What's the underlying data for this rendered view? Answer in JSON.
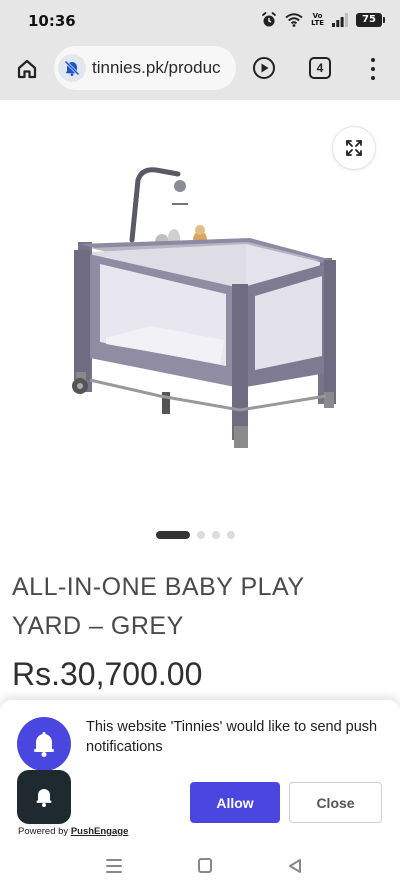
{
  "status_bar": {
    "time": "10:36",
    "lte_top": "Vo",
    "lte_bottom": "LTE",
    "battery": "75"
  },
  "browser": {
    "url": "tinnies.pk/produc",
    "tab_count": "4"
  },
  "product": {
    "title": "ALL-IN-ONE BABY PLAY YARD – GREY",
    "price": "Rs.30,700.00",
    "image_carousel": {
      "total_slides": 4,
      "active_slide": 1
    }
  },
  "push_prompt": {
    "message": "This website 'Tinnies' would like to send push notifications",
    "allow_label": "Allow",
    "close_label": "Close",
    "powered_prefix": "Powered by ",
    "powered_brand": "PushEngage"
  },
  "colors": {
    "accent": "#4a47e0",
    "dark_icon_bg": "#1f2a30",
    "browser_bar": "#e6e6e6",
    "product_grey": "#8a879d"
  },
  "icons": {
    "alarm": "alarm-icon",
    "wifi": "wifi-icon",
    "signal": "signal-icon",
    "home": "home-icon",
    "site": "notifications-off-icon",
    "play": "play-icon",
    "menu": "more-vert-icon",
    "zoom": "expand-icon",
    "bell": "bell-icon"
  }
}
